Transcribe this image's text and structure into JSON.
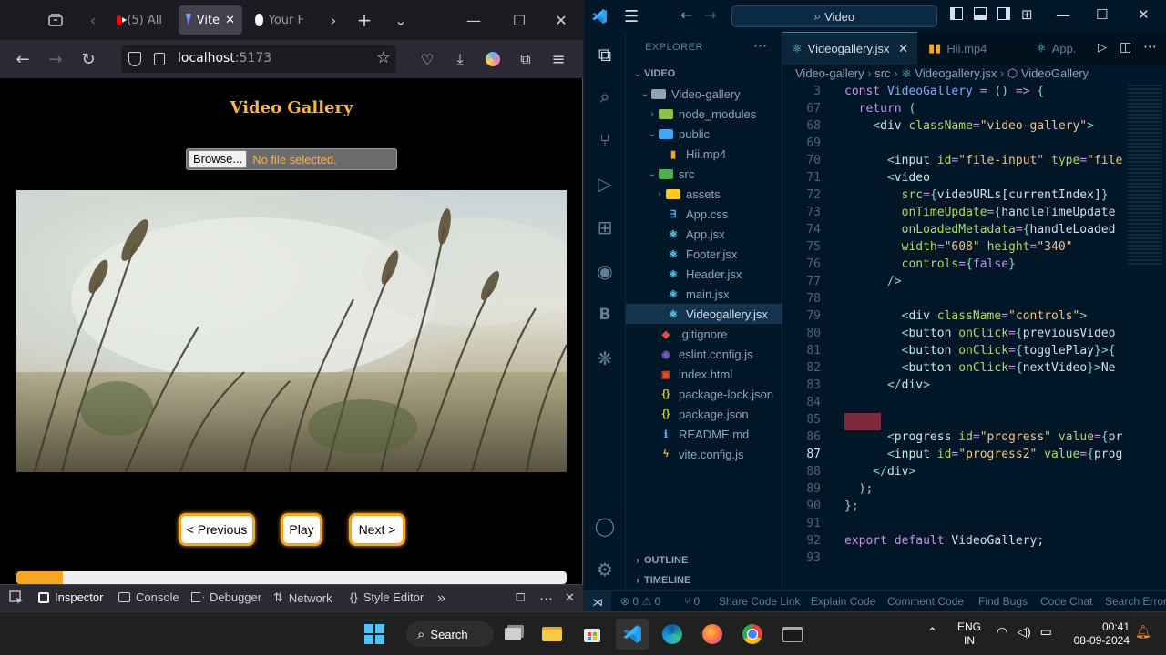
{
  "browser": {
    "tabs": [
      {
        "label": "(5) All"
      },
      {
        "label": "Vite"
      },
      {
        "label": "Your F"
      }
    ],
    "url_host": "localhost",
    "url_port": ":5173",
    "page": {
      "title": "Video Gallery",
      "browse_label": "Browse...",
      "no_file_label": "No file selected.",
      "prev_label": "< Previous",
      "play_label": "Play",
      "next_label": "Next >",
      "progress_fraction": 0.085
    },
    "devtools": {
      "tabs": [
        "Inspector",
        "Console",
        "Debugger",
        "Network",
        "Style Editor"
      ]
    }
  },
  "vscode": {
    "search_label": "Video",
    "explorer_label": "EXPLORER",
    "tabs": [
      {
        "label": "Videogallery.jsx"
      },
      {
        "label": "Hii.mp4"
      },
      {
        "label": "App."
      }
    ],
    "breadcrumb": [
      "Video-gallery",
      "src",
      "Videogallery.jsx",
      "VideoGallery"
    ],
    "tree": [
      {
        "label": "VIDEO",
        "depth": 0,
        "kind": "root"
      },
      {
        "label": "Video-gallery",
        "depth": 1,
        "kind": "folder-open"
      },
      {
        "label": "node_modules",
        "depth": 2,
        "kind": "folder-closed"
      },
      {
        "label": "public",
        "depth": 2,
        "kind": "folder-open"
      },
      {
        "label": "Hii.mp4",
        "depth": 3,
        "kind": "video"
      },
      {
        "label": "src",
        "depth": 2,
        "kind": "folder-open"
      },
      {
        "label": "assets",
        "depth": 3,
        "kind": "folder-closed"
      },
      {
        "label": "App.css",
        "depth": 3,
        "kind": "css"
      },
      {
        "label": "App.jsx",
        "depth": 3,
        "kind": "react"
      },
      {
        "label": "Footer.jsx",
        "depth": 3,
        "kind": "react"
      },
      {
        "label": "Header.jsx",
        "depth": 3,
        "kind": "react"
      },
      {
        "label": "main.jsx",
        "depth": 3,
        "kind": "react"
      },
      {
        "label": "Videogallery.jsx",
        "depth": 3,
        "kind": "react",
        "selected": true
      },
      {
        "label": ".gitignore",
        "depth": 2,
        "kind": "git"
      },
      {
        "label": "eslint.config.js",
        "depth": 2,
        "kind": "eslint"
      },
      {
        "label": "index.html",
        "depth": 2,
        "kind": "html"
      },
      {
        "label": "package-lock.json",
        "depth": 2,
        "kind": "json"
      },
      {
        "label": "package.json",
        "depth": 2,
        "kind": "json"
      },
      {
        "label": "README.md",
        "depth": 2,
        "kind": "info"
      },
      {
        "label": "vite.config.js",
        "depth": 2,
        "kind": "vite"
      }
    ],
    "outline_label": "OUTLINE",
    "timeline_label": "TIMELINE",
    "code_lines": [
      {
        "n": "3",
        "html": "<span class='kw'>const</span> <span class='fn'>VideoGallery</span> <span class='kw'>=</span> <span class='br'>()</span> <span class='kw'>=&gt;</span> <span class='br'>{</span>"
      },
      {
        "n": "67",
        "html": "  <span class='kw'>return</span> <span class='br'>(</span>"
      },
      {
        "n": "68",
        "html": "    <span class='br'>&lt;</span><span class='tag'>div</span> <span class='attr'>className</span><span class='kw'>=</span><span class='str'>\"video-gallery\"</span><span class='br'>&gt;</span>"
      },
      {
        "n": "69",
        "html": ""
      },
      {
        "n": "70",
        "html": "      <span class='br'>&lt;</span><span class='tag'>input</span> <span class='attr'>id</span><span class='kw'>=</span><span class='str'>\"file-input\"</span> <span class='attr'>type</span><span class='kw'>=</span><span class='str'>\"file</span>"
      },
      {
        "n": "71",
        "html": "      <span class='br'>&lt;</span><span class='tag'>video</span>"
      },
      {
        "n": "72",
        "html": "        <span class='attr'>src</span><span class='kw'>=</span><span class='br'>{</span><span class='vr'>videoURLs[currentIndex]</span><span class='br'>}</span>"
      },
      {
        "n": "73",
        "html": "        <span class='attr'>onTimeUpdate</span><span class='kw'>=</span><span class='br'>{</span><span class='vr'>handleTimeUpdate</span>"
      },
      {
        "n": "74",
        "html": "        <span class='attr'>onLoadedMetadata</span><span class='kw'>=</span><span class='br'>{</span><span class='vr'>handleLoaded</span>"
      },
      {
        "n": "75",
        "html": "        <span class='attr'>width</span><span class='kw'>=</span><span class='str'>\"608\"</span> <span class='attr'>height</span><span class='kw'>=</span><span class='str'>\"340\"</span>"
      },
      {
        "n": "76",
        "html": "        <span class='attr'>controls</span><span class='kw'>=</span><span class='br'>{</span><span class='kw'>false</span><span class='br'>}</span>"
      },
      {
        "n": "77",
        "html": "      <span class='br'>/&gt;</span>"
      },
      {
        "n": "78",
        "html": ""
      },
      {
        "n": "79",
        "html": "        <span class='br'>&lt;</span><span class='tag'>div</span> <span class='attr'>className</span><span class='kw'>=</span><span class='str'>\"controls\"</span><span class='br'>&gt;</span>"
      },
      {
        "n": "80",
        "html": "        <span class='br'>&lt;</span><span class='tag'>button</span> <span class='attr'>onClick</span><span class='kw'>=</span><span class='br'>{</span><span class='vr'>previousVideo</span>"
      },
      {
        "n": "81",
        "html": "        <span class='br'>&lt;</span><span class='tag'>button</span> <span class='attr'>onClick</span><span class='kw'>=</span><span class='br'>{</span><span class='vr'>togglePlay</span><span class='br'>}&gt;{</span>"
      },
      {
        "n": "82",
        "html": "        <span class='br'>&lt;</span><span class='tag'>button</span> <span class='attr'>onClick</span><span class='kw'>=</span><span class='br'>{</span><span class='vr'>nextVideo</span><span class='br'>}&gt;</span>Ne"
      },
      {
        "n": "83",
        "html": "      <span class='br'>&lt;/</span><span class='tag'>div</span><span class='br'>&gt;</span>"
      },
      {
        "n": "84",
        "html": ""
      },
      {
        "n": "85",
        "html": ""
      },
      {
        "n": "86",
        "html": "      <span class='br'>&lt;</span><span class='tag'>progress</span> <span class='attr'>id</span><span class='kw'>=</span><span class='str'>\"progress\"</span> <span class='attr'>value</span><span class='kw'>=</span><span class='br'>{</span>pr"
      },
      {
        "n": "87",
        "html": "      <span class='br'>&lt;</span><span class='tag'>input</span> <span class='attr'>id</span><span class='kw'>=</span><span class='str'>\"progress2\"</span> <span class='attr'>value</span><span class='kw'>=</span><span class='br'>{</span>prog"
      },
      {
        "n": "88",
        "html": "    <span class='br'>&lt;/</span><span class='tag'>div</span><span class='br'>&gt;</span>"
      },
      {
        "n": "89",
        "html": "  <span class='br'>);</span>"
      },
      {
        "n": "90",
        "html": "<span class='br'>};</span>"
      },
      {
        "n": "91",
        "html": ""
      },
      {
        "n": "92",
        "html": "<span class='kw'>export default</span> <span class='vr'>VideoGallery;</span>"
      },
      {
        "n": "93",
        "html": ""
      }
    ],
    "current_line": "87",
    "status": {
      "errors": "0",
      "warnings": "0",
      "ports": "0",
      "items": [
        "Share Code Link",
        "Explain Code",
        "Comment Code",
        "Find Bugs",
        "Code Chat",
        "Search Error"
      ]
    }
  },
  "taskbar": {
    "search_label": "Search",
    "lang_top": "ENG",
    "lang_bottom": "IN",
    "time": "00:41",
    "date": "08-09-2024"
  },
  "colors": {
    "accent_orange": "#f6a623",
    "title_gold": "#f6b44a",
    "vscode_bg": "#011627"
  }
}
